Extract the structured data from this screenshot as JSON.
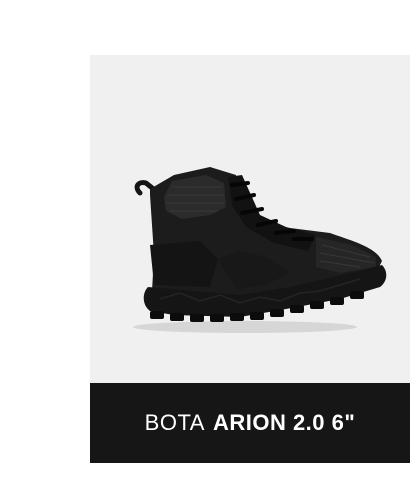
{
  "product": {
    "image_icon": "black-tactical-boot-icon",
    "name_prefix": "BOTA",
    "name_model": "ARION 2.0 6\""
  },
  "colors": {
    "page_background": "#ffffff",
    "card_background": "#f0f0f0",
    "name_bar_background": "#161616",
    "name_text": "#ffffff"
  }
}
